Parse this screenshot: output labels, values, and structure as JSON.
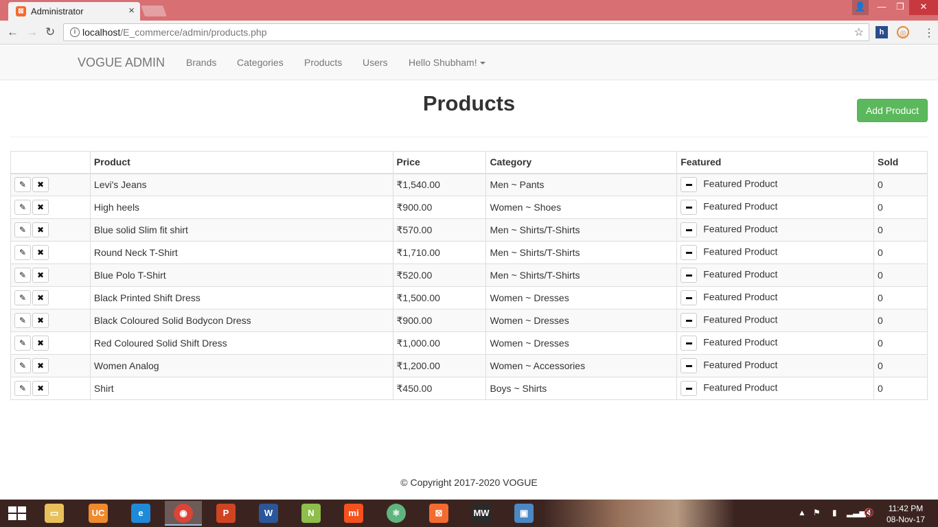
{
  "browser": {
    "tab_title": "Administrator",
    "tab_close": "×",
    "url_host": "localhost",
    "url_path": "/E_commerce/admin/products.php"
  },
  "navbar": {
    "brand": "VOGUE ADMIN",
    "links": [
      "Brands",
      "Categories",
      "Products",
      "Users"
    ],
    "user_menu": "Hello Shubham!"
  },
  "page": {
    "title": "Products",
    "add_button": "Add Product"
  },
  "table": {
    "columns": [
      "",
      "Product",
      "Price",
      "Category",
      "Featured",
      "Sold"
    ],
    "rows": [
      {
        "product": "Levi's Jeans",
        "price": "₹1,540.00",
        "category": "Men ~ Pants",
        "featured": "Featured Product",
        "sold": "0"
      },
      {
        "product": "High heels",
        "price": "₹900.00",
        "category": "Women ~ Shoes",
        "featured": "Featured Product",
        "sold": "0"
      },
      {
        "product": "Blue solid Slim fit shirt",
        "price": "₹570.00",
        "category": "Men ~ Shirts/T-Shirts",
        "featured": "Featured Product",
        "sold": "0"
      },
      {
        "product": "Round Neck T-Shirt",
        "price": "₹1,710.00",
        "category": "Men ~ Shirts/T-Shirts",
        "featured": "Featured Product",
        "sold": "0"
      },
      {
        "product": "Blue Polo T-Shirt",
        "price": "₹520.00",
        "category": "Men ~ Shirts/T-Shirts",
        "featured": "Featured Product",
        "sold": "0"
      },
      {
        "product": "Black Printed Shift Dress",
        "price": "₹1,500.00",
        "category": "Women ~ Dresses",
        "featured": "Featured Product",
        "sold": "0"
      },
      {
        "product": "Black Coloured Solid Bodycon Dress",
        "price": "₹900.00",
        "category": "Women ~ Dresses",
        "featured": "Featured Product",
        "sold": "0"
      },
      {
        "product": "Red Coloured Solid Shift Dress",
        "price": "₹1,000.00",
        "category": "Women ~ Dresses",
        "featured": "Featured Product",
        "sold": "0"
      },
      {
        "product": "Women Analog",
        "price": "₹1,200.00",
        "category": "Women ~ Accessories",
        "featured": "Featured Product",
        "sold": "0"
      },
      {
        "product": "Shirt",
        "price": "₹450.00",
        "category": "Boys ~ Shirts",
        "featured": "Featured Product",
        "sold": "0"
      }
    ]
  },
  "footer": {
    "copyright": "© Copyright 2017-2020 VOGUE"
  },
  "taskbar": {
    "time": "11:42 PM",
    "date": "08-Nov-17"
  },
  "colors": {
    "accent_success": "#5cb85c",
    "titlebar": "#d76f73",
    "navbar_bg": "#f8f8f8"
  }
}
